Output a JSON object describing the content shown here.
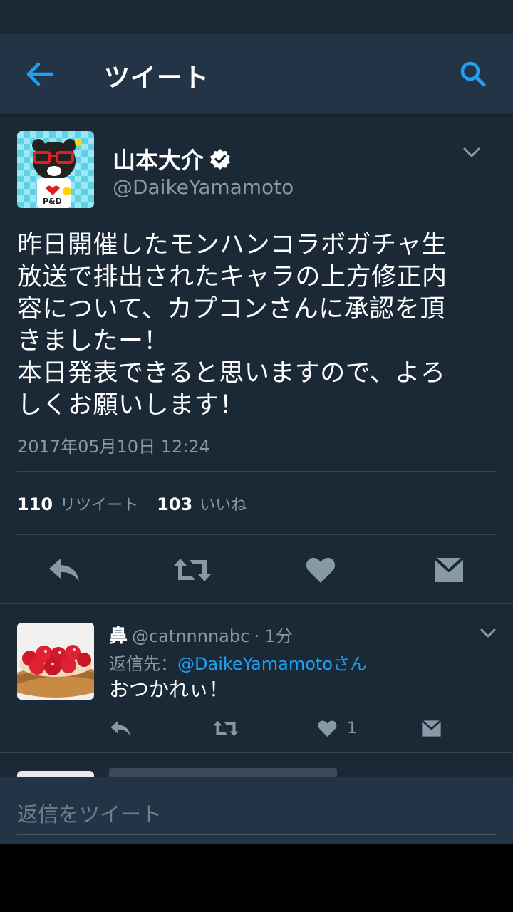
{
  "header": {
    "title": "ツイート"
  },
  "tweet": {
    "author_name": "山本大介",
    "author_handle": "@DaikeYamamoto",
    "text": "昨日開催したモンハンコラボガチャ生\n放送で排出されたキャラの上方修正内\n容について、カプコンさんに承認を頂\nきましたー！\n本日発表できると思いますので、よろ\nしくお願いします！",
    "timestamp": "2017年05月10日 12:24",
    "retweets_count": "110",
    "retweets_label": "リツイート",
    "likes_count": "103",
    "likes_label": "いいね"
  },
  "reply": {
    "author_name": "鼻",
    "author_handle": "@catnnnnabc",
    "time": "· 1分",
    "reply_to_prefix": "返信先：",
    "reply_to_handle": "@DaikeYamamotoさん",
    "text": "おつかれぃ！",
    "like_count": "1"
  },
  "compose": {
    "placeholder": "返信をツイート"
  },
  "colors": {
    "accent": "#1da1f2",
    "background": "#1b2836",
    "bar": "#243447",
    "muted": "#8899a6"
  }
}
